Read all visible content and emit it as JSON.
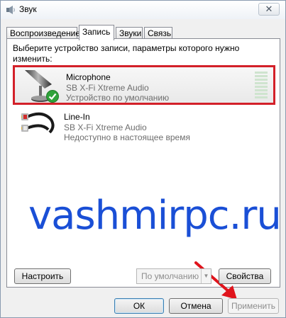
{
  "window": {
    "title": "Звук",
    "close_glyph": "✕"
  },
  "tabs": [
    {
      "label": "Воспроизведение"
    },
    {
      "label": "Запись",
      "active": true
    },
    {
      "label": "Звуки"
    },
    {
      "label": "Связь"
    }
  ],
  "panel": {
    "instruction": "Выберите устройство записи, параметры которого нужно изменить:"
  },
  "devices": [
    {
      "name": "Microphone",
      "driver": "SB X-Fi Xtreme Audio",
      "status": "Устройство по умолчанию",
      "icon": "microphone-icon",
      "selected": true,
      "default": true
    },
    {
      "name": "Line-In",
      "driver": "SB X-Fi Xtreme Audio",
      "status": "Недоступно в настоящее время",
      "icon": "rca-cable-icon"
    }
  ],
  "watermark": "vashmirpc.ru",
  "panel_buttons": {
    "configure": "Настроить",
    "default_select": "По умолчанию",
    "properties": "Свойства"
  },
  "dialog_buttons": {
    "ok": "ОК",
    "cancel": "Отмена",
    "apply": "Применить"
  },
  "colors": {
    "selection_border": "#d32029",
    "watermark": "#1a4fd6",
    "arrow": "#e0141c",
    "default_check": "#2fa33a"
  }
}
